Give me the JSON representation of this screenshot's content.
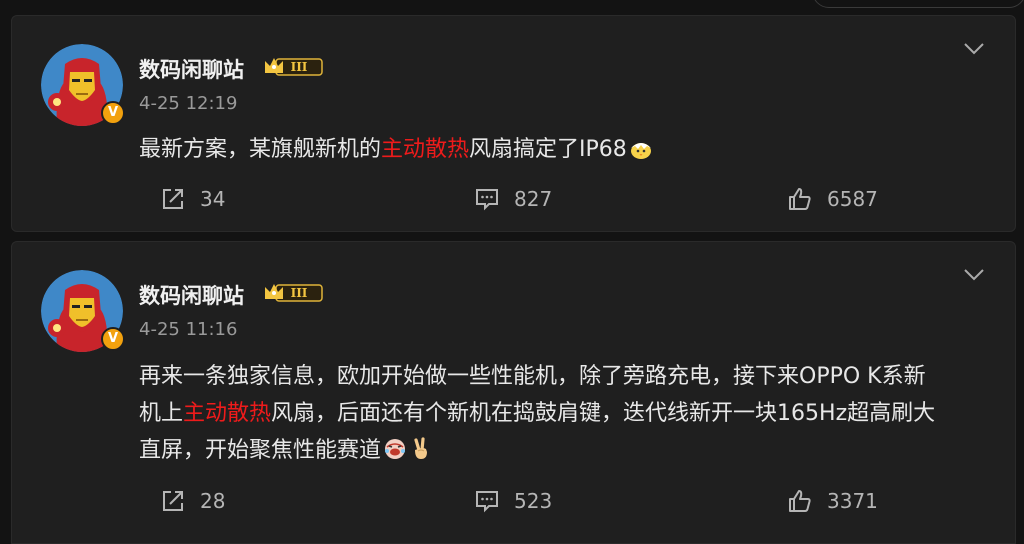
{
  "posts": [
    {
      "author": "数码闲聊站",
      "verified_badge": "V",
      "level_badge": "III",
      "time": "4-25 12:19",
      "content": {
        "before": "最新方案，某旗舰新机的",
        "highlight": "主动散热",
        "after": "风扇搞定了IP68"
      },
      "emoji": "chick-emoji",
      "actions": {
        "shares": "34",
        "comments": "827",
        "likes": "6587"
      }
    },
    {
      "author": "数码闲聊站",
      "verified_badge": "V",
      "level_badge": "III",
      "time": "4-25 11:16",
      "content": {
        "line1": "再来一条独家信息，欧加开始做一些性能机，除了旁路充电，接下来OPPO K系新",
        "line2_before": "机上",
        "line2_highlight": "主动散热",
        "line2_after": "风扇，后面还有个新机在捣鼓肩键，迭代线新开一块165Hz超高刷大",
        "line3": "直屏，开始聚焦性能赛道"
      },
      "emoji": [
        "laugh-cry-emoji",
        "victory-hand-emoji"
      ],
      "actions": {
        "shares": "28",
        "comments": "523",
        "likes": "3371"
      }
    }
  ],
  "colors": {
    "background": "#131313",
    "card": "#1f1f1f",
    "highlight": "#ee1b1b",
    "badge": "#f2a10e",
    "muted": "#9a9a9a"
  }
}
